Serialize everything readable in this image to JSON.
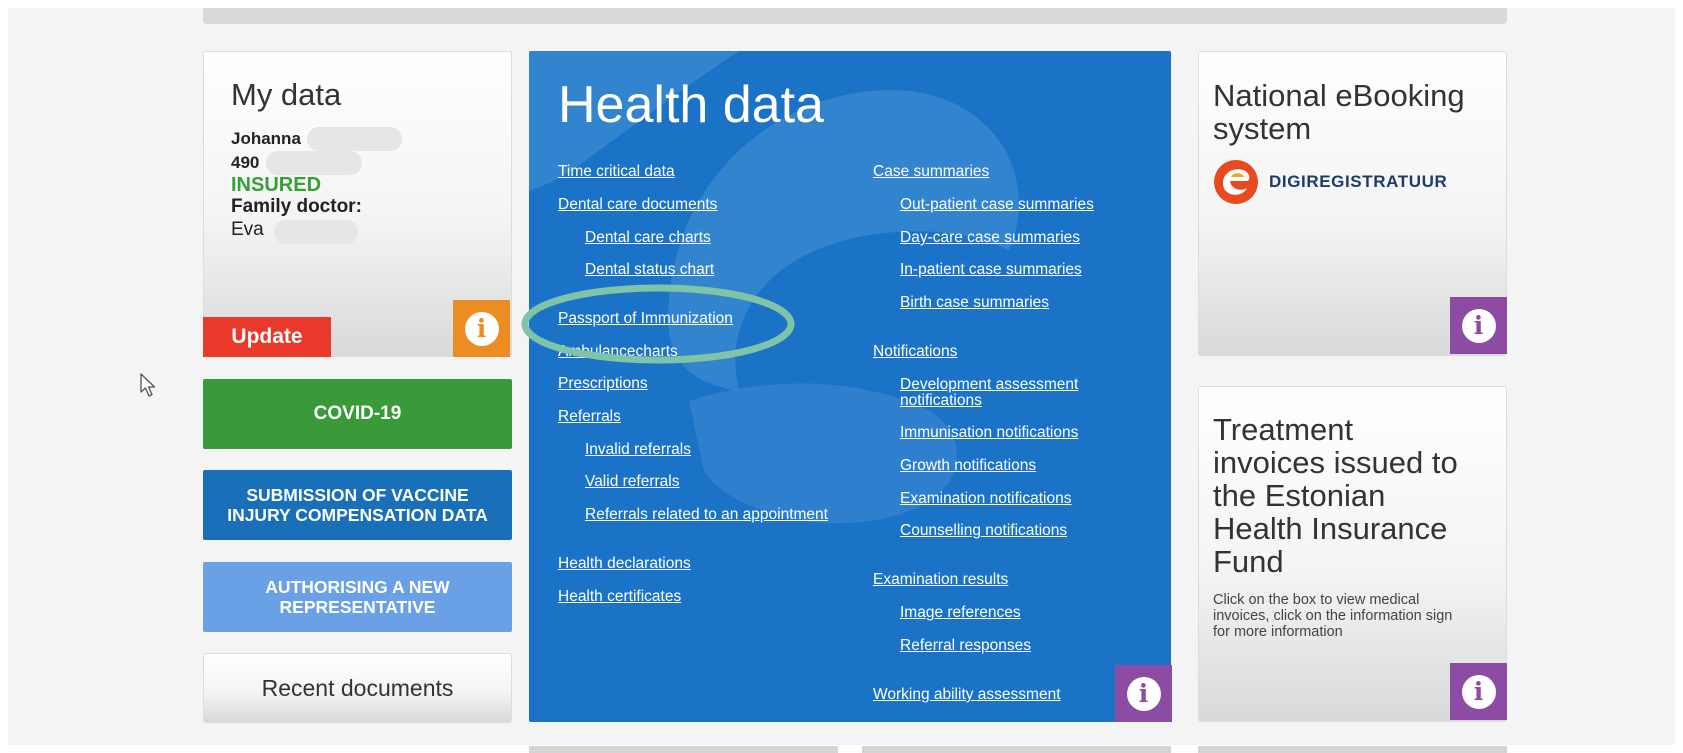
{
  "my_data": {
    "title": "My data",
    "name": "Johanna",
    "id_prefix": "490",
    "status": "INSURED",
    "doctor_label": "Family doctor:",
    "doctor_name": "Eva",
    "update_label": "Update"
  },
  "buttons": {
    "covid": "COVID-19",
    "vaccine_line1": "SUBMISSION OF VACCINE",
    "vaccine_line2": "INJURY COMPENSATION DATA",
    "rep_line1": "AUTHORISING A NEW",
    "rep_line2": "REPRESENTATIVE",
    "recent": "Recent documents"
  },
  "health_data": {
    "title": "Health data",
    "left_links": {
      "time_critical": "Time critical data",
      "dental_docs": "Dental care documents",
      "dental_charts": "Dental care charts",
      "dental_status": "Dental status chart",
      "passport": "Passport of Immunization",
      "ambulance": "Ambulancecharts",
      "prescriptions": "Prescriptions",
      "referrals": "Referrals",
      "invalid_referrals": "Invalid referrals",
      "valid_referrals": "Valid referrals",
      "referrals_appointment": "Referrals related to an appointment",
      "health_declarations": "Health declarations",
      "health_certificates": "Health certificates"
    },
    "right_links": {
      "case_summaries": "Case summaries",
      "outpatient": "Out-patient case summaries",
      "daycare": "Day-care case summaries",
      "inpatient": "In-patient case summaries",
      "birth": "Birth case summaries",
      "notifications": "Notifications",
      "development_1": "Development assessment",
      "development_2": "notifications",
      "immunisation": "Immunisation notifications",
      "growth": "Growth notifications",
      "examination_notif": "Examination notifications",
      "counselling": "Counselling notifications",
      "examination_results": "Examination results",
      "image_refs": "Image references",
      "referral_responses": "Referral responses",
      "working_ability": "Working ability assessment"
    }
  },
  "ebooking": {
    "title_line1": "National eBooking",
    "title_line2": "system",
    "logo_text": "DIGIREGISTRATUUR"
  },
  "invoices": {
    "title_lines": [
      "Treatment",
      "invoices issued to",
      "the Estonian",
      "Health Insurance",
      "Fund"
    ],
    "desc_lines": [
      "Click on the box to view medical",
      "invoices, click on the information sign",
      "for more information"
    ]
  },
  "colors": {
    "health_blue": "#1a73c7",
    "insured_green": "#35a035",
    "update_red": "#e8392a",
    "covid_green": "#3a9a3a",
    "vaccine_blue": "#1a70b8",
    "rep_blue": "#6aa0e6",
    "info_orange": "#ec8d24",
    "info_purple": "#8c4ca3",
    "highlight_teal": "#7fc3a8"
  },
  "icons": {
    "info": "info-icon",
    "cursor": "cursor-icon",
    "logo": "digiregistratuur-logo"
  }
}
